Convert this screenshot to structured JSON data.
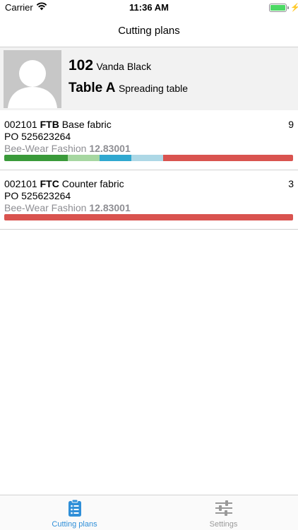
{
  "status_bar": {
    "carrier": "Carrier",
    "time": "11:36 AM",
    "battery_level": 1.0
  },
  "nav": {
    "title": "Cutting plans"
  },
  "header": {
    "number": "102",
    "name": "Vanda Black",
    "table_name": "Table A",
    "table_type": "Spreading table",
    "avatar_icon": "person-placeholder-icon"
  },
  "plans": [
    {
      "code": "002101",
      "fabric_code": "FTB",
      "fabric_name": "Base fabric",
      "count": "9",
      "po": "PO 525623264",
      "customer": "Bee-Wear Fashion",
      "reference": "12.83001",
      "progress": [
        {
          "color": "#3a9a3a",
          "fraction": 0.22
        },
        {
          "color": "#a6d7a1",
          "fraction": 0.11
        },
        {
          "color": "#30a8d0",
          "fraction": 0.11
        },
        {
          "color": "#add8e6",
          "fraction": 0.11
        },
        {
          "color": "#d9534f",
          "fraction": 0.45
        }
      ]
    },
    {
      "code": "002101",
      "fabric_code": "FTC",
      "fabric_name": "Counter fabric",
      "count": "3",
      "po": "PO 525623264",
      "customer": "Bee-Wear Fashion",
      "reference": "12.83001",
      "progress": [
        {
          "color": "#d9534f",
          "fraction": 1.0
        }
      ]
    }
  ],
  "tabs": [
    {
      "label": "Cutting plans",
      "icon": "clipboard-list-icon",
      "active": true
    },
    {
      "label": "Settings",
      "icon": "sliders-icon",
      "active": false
    }
  ],
  "colors": {
    "accent": "#2f8fd8",
    "inactive_tab": "#999999",
    "header_bg": "#f2f2f2",
    "secondary_text": "#8e8e93"
  }
}
